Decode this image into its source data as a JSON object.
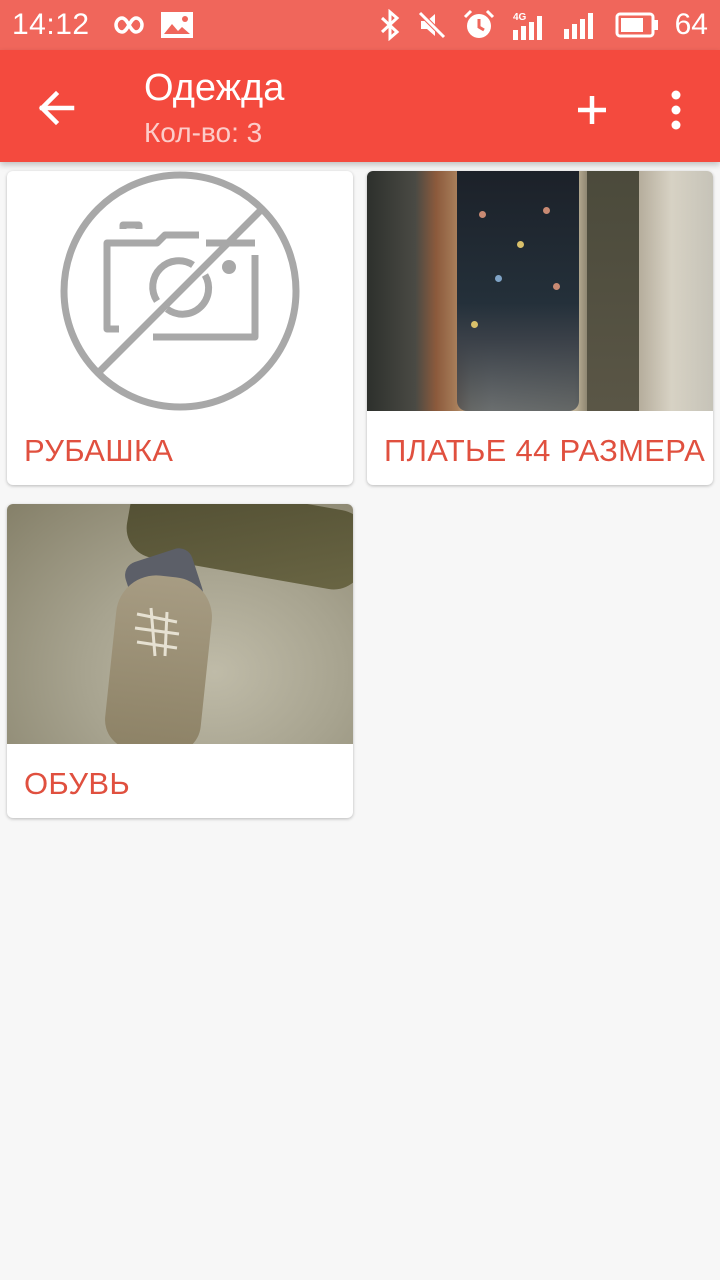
{
  "status_bar": {
    "time": "14:12",
    "battery_percent": "64",
    "network_label": "4G"
  },
  "app_bar": {
    "title": "Одежда",
    "subtitle": "Кол-во: 3"
  },
  "items": [
    {
      "label": "РУБАШКА",
      "image": "no-photo-icon"
    },
    {
      "label": "ПЛАТЬЕ 44 РАЗМЕРА",
      "image": "dress-photo"
    },
    {
      "label": "ОБУВЬ",
      "image": "shoe-photo"
    }
  ],
  "colors": {
    "status_bar": "#f0665b",
    "app_bar": "#f44a3e",
    "accent_text": "#e0503f",
    "background": "#f7f7f7",
    "placeholder_gray": "#a8a8a8"
  }
}
